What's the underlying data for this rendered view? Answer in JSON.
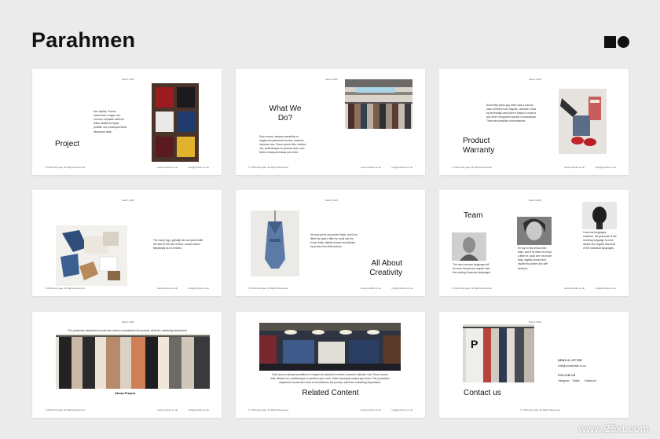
{
  "brand": {
    "title": "Parahmen"
  },
  "watermark": "www.25xt.com",
  "slides": [
    {
      "title": "Project",
      "date": "March 2020",
      "body": "Duo bipilas, Proimo elementum congue nec rhoncus vulputate eleifend tellus. Mattis leo ligula porttitor nec consequat tellus, vitaeducut sitae.",
      "foot_left": "© 2020 dark gate. All Rights Reserved",
      "foot_mid": "www.portfolio.co.uk",
      "foot_right": "info@portfolio.co.uk"
    },
    {
      "title": "What We Do?",
      "date": "March 2020",
      "body": "Duis cursus, natoque penatibus et magnis dis parturient montes, nascetur ridiculus mus. Donec quam felis, ultricies nec, pellentesque eu pretium quis, sem. Nulla consequat massa quis enim.",
      "foot_left": "© 2020 dark gate. All Rights Reserved",
      "foot_mid": "www.portfolio.co.uk",
      "foot_right": "info@portfolio.co.uk"
    },
    {
      "title": "Product Warranty",
      "date": "March 2020",
      "body": "Some fifty years ago there was a curious case of letters from Nigeria. Likewise a flick by technically vast when it leaves a mark to any other recognized symbol of possession. There are possible circumstances.",
      "foot_left": "© 2020 dark gate. All Rights Reserved",
      "foot_mid": "www.portfolio.co.uk",
      "foot_right": "info@portfolio.co.uk"
    },
    {
      "title": "",
      "date": "March 2020",
      "body": "The many logo, globally this compared with the size of the size of floor, around about fishplicaity as for beserut.",
      "foot_left": "© 2020 dark gate. All Rights Reserved",
      "foot_mid": "www.portfolio.co.uk",
      "foot_right": "info@portfolio.co.uk"
    },
    {
      "title": "All About Creativity",
      "date": "March 2020",
      "body": "He has sat he around the fresh, and if he lifted his head a little he could see his brown belly, slightly domed and divided by arches into stiff sections.",
      "foot_left": "© 2020 dark gate. All Rights Reserved",
      "foot_mid": "www.portfolio.co.uk",
      "foot_right": "info@portfolio.co.uk"
    },
    {
      "title": "Team",
      "date": "March 2020",
      "body1": "The new common language will be more simple and regular than the existing European languages.",
      "body2": "He lay on his armour-like back, and if he lifted his head a little he could see his brown belly, slightly domed and divided by arches into stiff sections.",
      "body3": "If several languages coalesce, the grammar of the resulting language is more simple and regular than that of the individual languages.",
      "foot_left": "© 2020 dark gate. All Rights Reserved",
      "foot_mid": "www.portfolio.co.uk",
      "foot_right": "info@portfolio.co.uk"
    },
    {
      "title": "About Project",
      "date": "March 2020",
      "body": "The production department would then start to manufacture the product, while the marketing department",
      "foot_left": "© 2020 dark gate. All Rights Reserved",
      "foot_mid": "www.portfolio.co.uk",
      "foot_right": "info@portfolio.co.uk"
    },
    {
      "title": "Related Content",
      "date": "March 2020",
      "body": "Duis cursus natoque penatibus et magnis dis parturient montes, nascetur ridiculus mus. Donec quam felis ultricies nec, pellentesque eu pretium quis, sem. Nulla consequat massa quis enim. The production department would then start to manufacture the product, while the marketing department.",
      "foot_left": "© 2020 dark gate. All Rights Reserved",
      "foot_mid": "www.portfolio.co.uk",
      "foot_right": "info@portfolio.co.uk"
    },
    {
      "title": "Contact us",
      "date": "March 2020",
      "news_label": "NEWS & LETTER",
      "news_value": "mail@yourwebsite.co.uk",
      "follow_label": "FOLLOW US",
      "follow_items": [
        "Instagram",
        "Twitter",
        "Facebook"
      ],
      "foot_left": "© 2020 dark gate. All Rights Reserved"
    }
  ],
  "colors": {
    "background": "#ebebeb",
    "slide": "#ffffff",
    "text": "#111111"
  }
}
